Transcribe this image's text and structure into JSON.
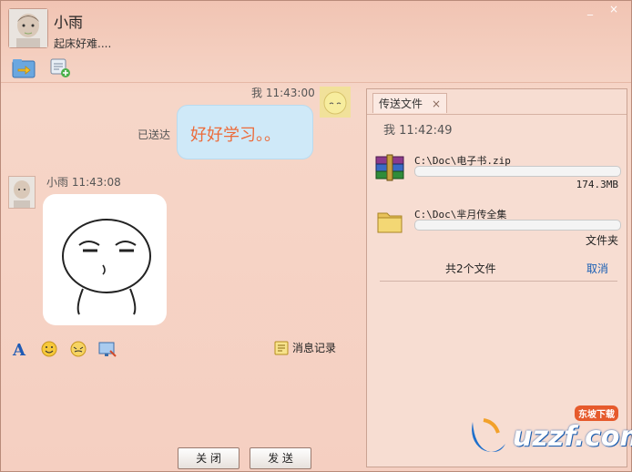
{
  "window_buttons": {
    "minimize": "_",
    "close": "×"
  },
  "contact": {
    "nickname": "小雨",
    "status": "起床好难...."
  },
  "toolbar": {
    "icons": [
      "send-file-icon",
      "add-chat-icon"
    ]
  },
  "chat": {
    "messages": [
      {
        "sender": "我",
        "time": "11:43:00",
        "meta": "我 11:43:00",
        "text": "好好学习。。",
        "delivery": "已送达",
        "side": "right"
      },
      {
        "sender": "小雨",
        "time": "11:43:08",
        "meta": "小雨 11:43:08",
        "content": "sticker",
        "side": "left"
      }
    ]
  },
  "input_toolbar": {
    "icons": [
      "font-icon",
      "emoji-icon",
      "gif-emoji-icon",
      "screenshot-icon"
    ],
    "history_label": "消息记录"
  },
  "footer": {
    "close_label": "关 闭",
    "send_label": "发 送"
  },
  "transfer_panel": {
    "tab_label": "传送文件",
    "tab_close": "×",
    "sender_time": "我  11:42:49",
    "files": [
      {
        "name": "C:\\Doc\\电子书.zip",
        "size": "174.3MB",
        "progress": 0,
        "icon": "zip-archive-icon"
      },
      {
        "name": "C:\\Doc\\芈月传全集",
        "size": "文件夹",
        "progress": 0,
        "icon": "folder-icon"
      }
    ],
    "total_label": "共2个文件",
    "cancel_label": "取消"
  },
  "watermark": {
    "text": "uzzf.com",
    "tag": "东坡下载"
  },
  "colors": {
    "accent_orange": "#ec6b3a",
    "bubble_blue": "#cfe9f8",
    "link_blue": "#1a5fb4"
  }
}
